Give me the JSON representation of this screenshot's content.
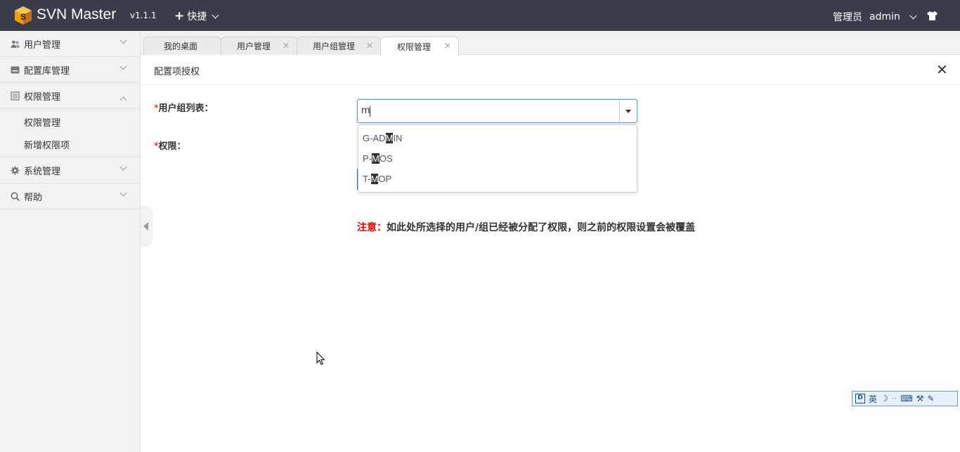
{
  "header": {
    "brand": "SVN Master",
    "version": "v1.1.1",
    "quick_label": "快捷",
    "role_label": "管理员",
    "username": "admin"
  },
  "sidebar": {
    "items": [
      {
        "label": "用户管理",
        "icon": "users-icon"
      },
      {
        "label": "配置库管理",
        "icon": "repository-icon"
      },
      {
        "label": "权限管理",
        "icon": "permission-icon",
        "expanded": true,
        "children": [
          {
            "label": "权限管理"
          },
          {
            "label": "新增权限项"
          }
        ]
      },
      {
        "label": "系统管理",
        "icon": "gear-icon"
      },
      {
        "label": "帮助",
        "icon": "search-icon"
      }
    ]
  },
  "tabs": [
    {
      "label": "我的桌面",
      "closable": false
    },
    {
      "label": "用户管理",
      "closable": true
    },
    {
      "label": "用户组管理",
      "closable": true
    },
    {
      "label": "权限管理",
      "closable": true,
      "active": true
    }
  ],
  "panel": {
    "title": "配置项授权",
    "close_glyph": "✕"
  },
  "form": {
    "required_mark": "*",
    "group_label": "用户组列表：",
    "permission_label": "权限：",
    "search_value": "m",
    "options": [
      {
        "before": "G-AD",
        "match": "M",
        "after": "IN"
      },
      {
        "before": "P-",
        "match": "M",
        "after": "OS"
      },
      {
        "before": "T-",
        "match": "M",
        "after": "OP"
      }
    ],
    "note_prefix": "注意：",
    "note_text": "如此处所选择的用户/组已经被分配了权限，则之前的权限设置会被覆盖"
  },
  "ime_toolbar": {
    "mode_label": "英"
  },
  "colors": {
    "topbar": "#393d49",
    "sidebar": "#f2f2f2",
    "focus_border": "#5b9bd5",
    "warning": "#e00000"
  }
}
